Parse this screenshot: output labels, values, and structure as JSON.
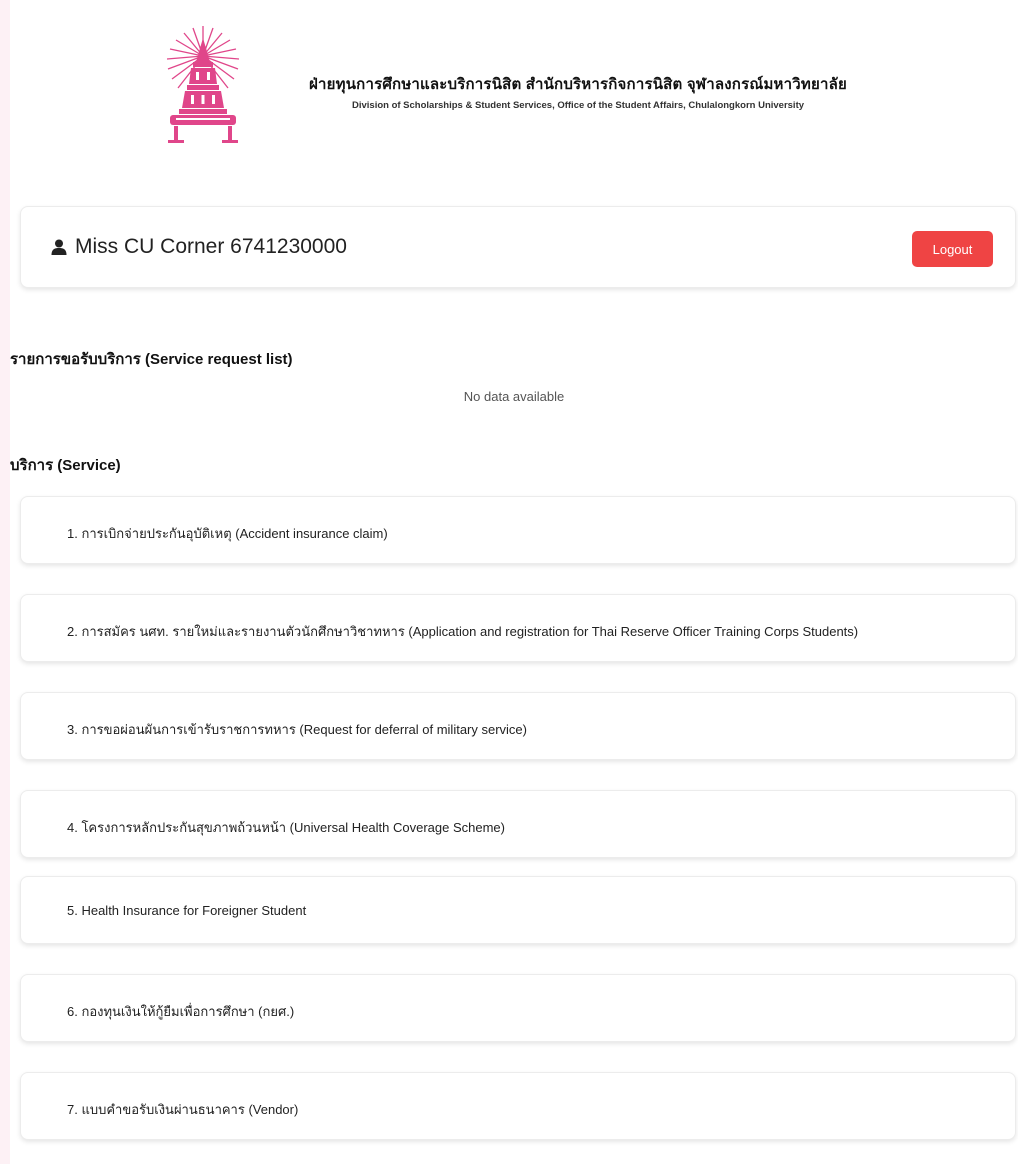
{
  "header": {
    "title_th": "ฝ่ายทุนการศึกษาและบริการนิสิต สำนักบริหารกิจการนิสิต จุฬาลงกรณ์มหาวิทยาลัย",
    "title_en": "Division of Scholarships & Student Services, Office of the Student Affairs, Chulalongkorn University",
    "seal_icon": "chulalongkorn-seal-icon",
    "brand_color": "#e0468a"
  },
  "user": {
    "icon": "user-icon",
    "name": "Miss CU Corner 6741230000",
    "logout_label": "Logout",
    "logout_color": "#ef4444"
  },
  "requests": {
    "title": "รายการขอรับบริการ (Service request list)",
    "empty_text": "No data available"
  },
  "services": {
    "title": "บริการ (Service)",
    "items": [
      {
        "label": "1. การเบิกจ่ายประกันอุบัติเหตุ (Accident insurance claim)"
      },
      {
        "label": "2. การสมัคร นศท. รายใหม่และรายงานตัวนักศึกษาวิชาทหาร (Application and registration for Thai Reserve Officer Training Corps Students)"
      },
      {
        "label": "3. การขอผ่อนผันการเข้ารับราชการทหาร (Request for deferral of military service)"
      },
      {
        "label": "4. โครงการหลักประกันสุขภาพถ้วนหน้า (Universal Health Coverage Scheme)"
      },
      {
        "label": "5. Health Insurance for Foreigner Student"
      },
      {
        "label": "6. กองทุนเงินให้กู้ยืมเพื่อการศึกษา (กยศ.)"
      },
      {
        "label": "7. แบบคำขอรับเงินผ่านธนาคาร (Vendor)"
      }
    ]
  }
}
